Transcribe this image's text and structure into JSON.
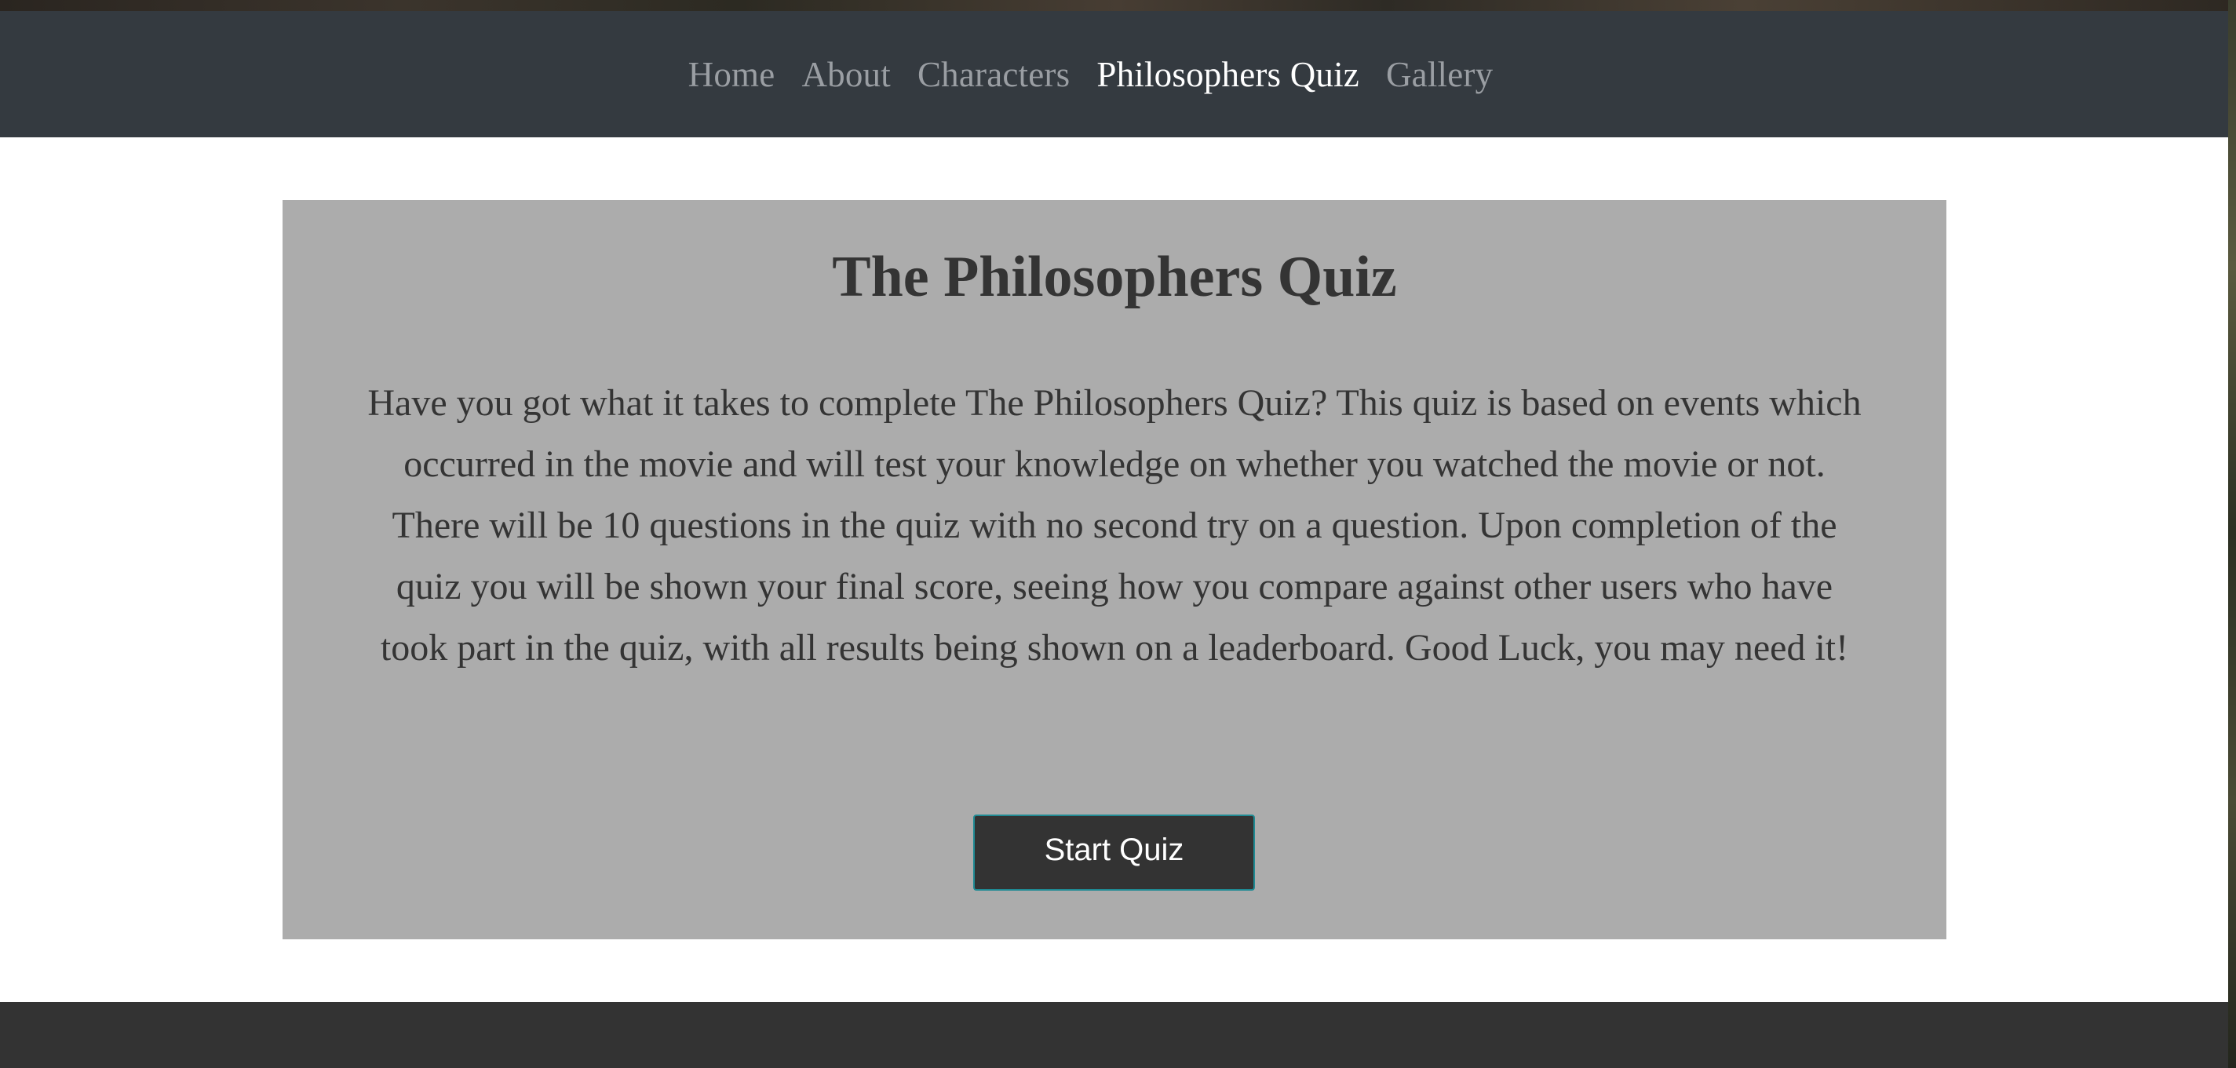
{
  "nav": {
    "items": [
      {
        "label": "Home"
      },
      {
        "label": "About"
      },
      {
        "label": "Characters"
      },
      {
        "label": "Philosophers Quiz"
      },
      {
        "label": "Gallery"
      }
    ],
    "active": "Philosophers Quiz"
  },
  "quiz": {
    "title": "The Philosophers Quiz",
    "description": "Have you got what it takes to complete The Philosophers Quiz? This quiz is based on events which occurred in the movie and will test your knowledge on whether you watched the movie or not. There will be 10 questions in the quiz with no second try on a question. Upon completion of the quiz you will be shown your final score, seeing how you compare against other users who have took part in the quiz, with all results being shown on a leaderboard. Good Luck, you may need it!",
    "start_label": "Start Quiz"
  },
  "colors": {
    "navbar_bg": "#343a40",
    "nav_inactive": "#9a9ea3",
    "nav_active": "#ffffff",
    "card_bg": "#acacac",
    "button_bg": "#333333",
    "button_border": "#1f8a93",
    "footer_bg": "#333333"
  }
}
